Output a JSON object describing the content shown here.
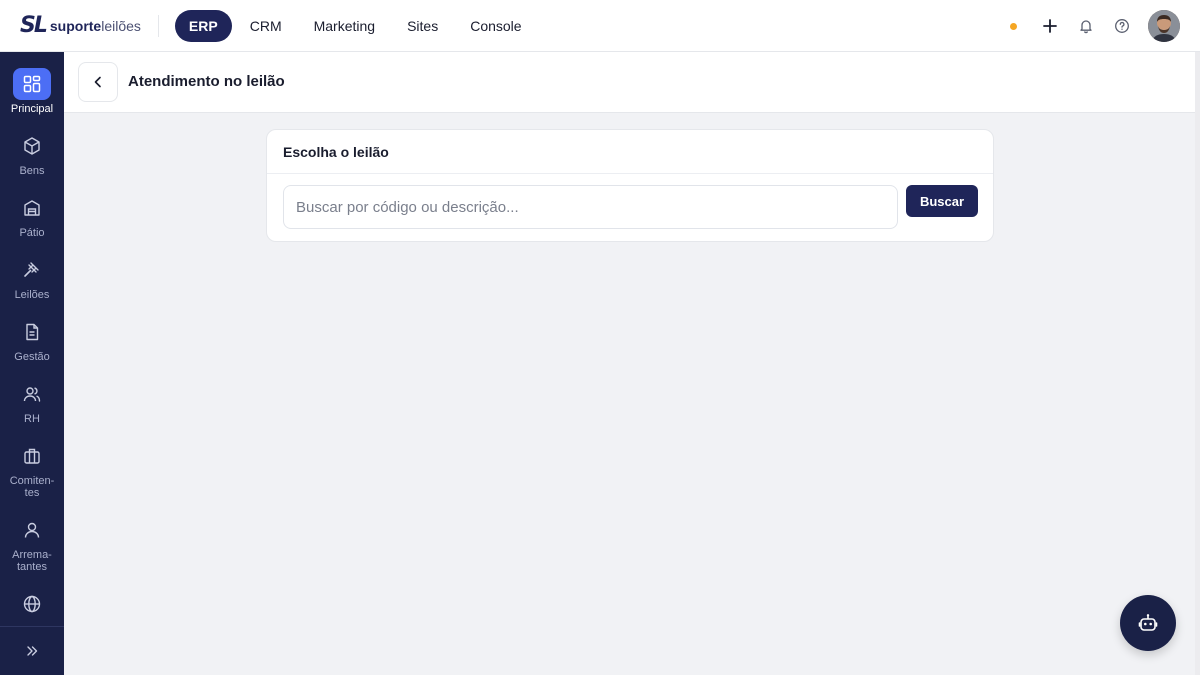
{
  "brand": {
    "mark": "SL",
    "name_bold": "suporte",
    "name_light": "leilões"
  },
  "topnav": {
    "items": [
      "ERP",
      "CRM",
      "Marketing",
      "Sites",
      "Console"
    ],
    "active": "ERP"
  },
  "topright": {
    "status_color": "#f5a623",
    "icons": [
      "plus-icon",
      "bell-icon",
      "help-icon"
    ]
  },
  "sidebar": {
    "items": [
      {
        "label": "Principal",
        "icon": "grid-icon",
        "active": true
      },
      {
        "label": "Bens",
        "icon": "box-icon"
      },
      {
        "label": "Pátio",
        "icon": "warehouse-icon"
      },
      {
        "label": "Leilões",
        "icon": "gavel-icon"
      },
      {
        "label": "Gestão",
        "icon": "document-icon"
      },
      {
        "label": "RH",
        "icon": "users-icon"
      },
      {
        "label": "Comiten-\ntes",
        "icon": "briefcase-icon"
      },
      {
        "label": "Arrema-\ntantes",
        "icon": "user-icon"
      },
      {
        "label": "",
        "icon": "globe-icon"
      }
    ],
    "collapse_icon": "chevrons-right-icon"
  },
  "header": {
    "title": "Atendimento no leilão"
  },
  "card": {
    "title": "Escolha o leilão",
    "search": {
      "placeholder": "Buscar por código ou descrição...",
      "value": ""
    },
    "button_label": "Buscar"
  },
  "colors": {
    "accent": "#4c6ef5",
    "brand_dark": "#1f2559",
    "sidebar_bg": "#1a2147"
  }
}
